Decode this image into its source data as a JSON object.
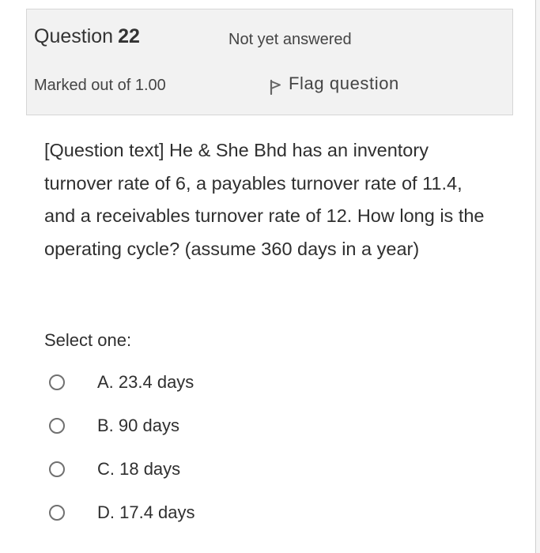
{
  "info": {
    "question_label": "Question",
    "question_number": "22",
    "state": "Not yet answered",
    "grade": "Marked out of 1.00",
    "flag_label": "Flag question",
    "flag_icon": "flag-icon"
  },
  "question": {
    "text": "[Question text] He & She Bhd has an inventory turnover rate of 6, a payables turnover rate of 11.4, and a receivables turnover rate of 12. How long is the operating cycle? (assume 360 days in a year)",
    "prompt": "Select one:",
    "options": [
      {
        "label": "A. 23.4 days",
        "selected": false
      },
      {
        "label": "B. 90 days",
        "selected": false
      },
      {
        "label": "C. 18 days",
        "selected": false
      },
      {
        "label": "D. 17.4 days",
        "selected": false
      }
    ]
  },
  "colors": {
    "info_background": "#f2f2f2",
    "info_border": "#d6d6d6",
    "text": "#333333",
    "radio_border": "#707070"
  }
}
